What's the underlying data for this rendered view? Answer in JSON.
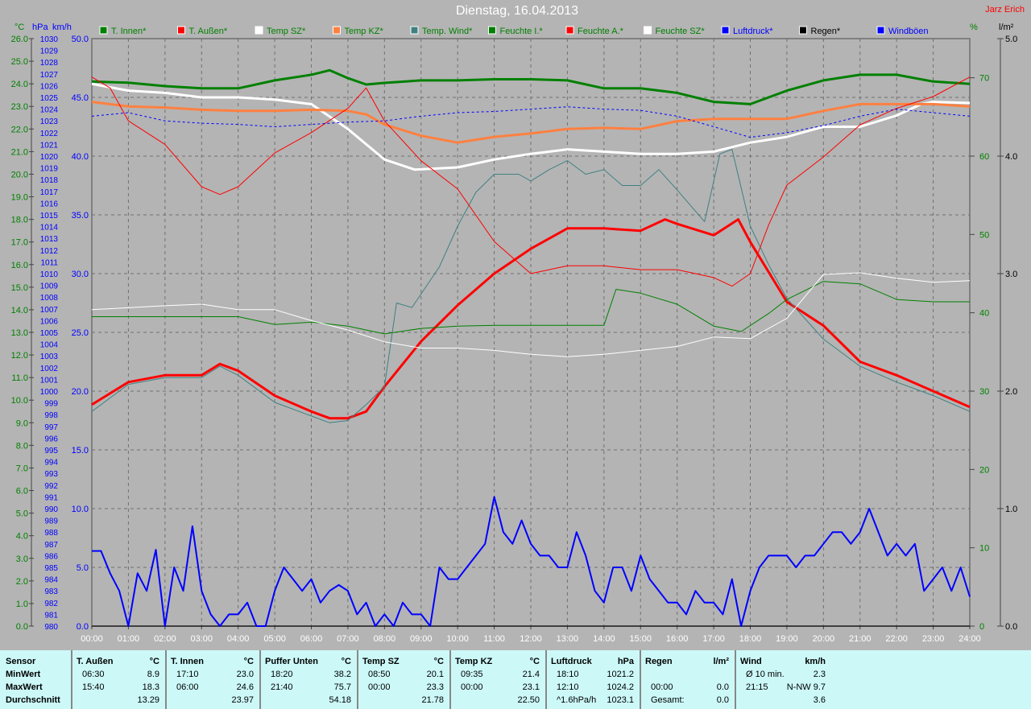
{
  "header": {
    "title": "Dienstag, 16.04.2013",
    "author": "Jarz Erich"
  },
  "axis_units": {
    "celsius": "°C",
    "hpa": "hPa",
    "kmh": "km/h",
    "percent": "%",
    "rain": "l/m²"
  },
  "chart_data": {
    "type": "line",
    "title": "Dienstag, 16.04.2013",
    "xlim": [
      0,
      24
    ],
    "x_ticks": [
      "00:00",
      "01:00",
      "02:00",
      "03:00",
      "04:00",
      "05:00",
      "06:00",
      "07:00",
      "08:00",
      "09:00",
      "10:00",
      "11:00",
      "12:00",
      "13:00",
      "14:00",
      "15:00",
      "16:00",
      "17:00",
      "18:00",
      "19:00",
      "20:00",
      "21:00",
      "22:00",
      "23:00",
      "24:00"
    ],
    "axes": {
      "celsius": {
        "range": [
          0,
          26
        ],
        "ticks": [
          "0.0",
          "1.0",
          "2.0",
          "3.0",
          "4.0",
          "5.0",
          "6.0",
          "7.0",
          "8.0",
          "9.0",
          "10.0",
          "11.0",
          "12.0",
          "13.0",
          "14.0",
          "15.0",
          "16.0",
          "17.0",
          "18.0",
          "19.0",
          "20.0",
          "21.0",
          "22.0",
          "23.0",
          "24.0",
          "25.0",
          "26.0"
        ],
        "color": "#008000"
      },
      "hpa": {
        "range": [
          980,
          1030
        ],
        "color": "#0000ff"
      },
      "kmh": {
        "range": [
          0,
          50
        ],
        "ticks": [
          "0.0",
          "5.0",
          "10.0",
          "15.0",
          "20.0",
          "25.0",
          "30.0",
          "35.0",
          "40.0",
          "45.0",
          "50.0"
        ],
        "color": "#0000ff"
      },
      "percent": {
        "range": [
          0,
          75
        ],
        "ticks": [
          "0",
          "10",
          "20",
          "30",
          "40",
          "50",
          "60",
          "70"
        ],
        "color": "#008000"
      },
      "rain": {
        "range": [
          0,
          5
        ],
        "ticks": [
          "0.0",
          "1.0",
          "2.0",
          "3.0",
          "4.0",
          "5.0"
        ],
        "color": "#000000"
      }
    },
    "grid": true,
    "legend_position": "top",
    "series": [
      {
        "name": "T. Innen*",
        "color": "#008000",
        "axis": "celsius",
        "width": 3,
        "x": [
          0,
          1,
          2,
          3,
          4,
          5,
          6,
          6.5,
          7,
          7.5,
          8,
          9,
          10,
          11,
          12,
          13,
          14,
          15,
          16,
          17,
          18,
          19,
          20,
          21,
          22,
          23,
          24
        ],
        "y": [
          24.1,
          24.05,
          23.9,
          23.8,
          23.8,
          24.15,
          24.4,
          24.6,
          24.25,
          23.97,
          24.04,
          24.15,
          24.15,
          24.2,
          24.2,
          24.15,
          23.8,
          23.8,
          23.6,
          23.2,
          23.1,
          23.7,
          24.15,
          24.4,
          24.4,
          24.1,
          24.0
        ]
      },
      {
        "name": "T. Außen*",
        "color": "#ff0000",
        "axis": "celsius",
        "width": 3,
        "x": [
          0,
          1,
          2,
          3,
          3.5,
          4,
          5,
          6,
          6.5,
          7,
          7.5,
          8,
          9,
          10,
          11,
          12,
          13,
          14,
          15,
          15.67,
          16,
          17,
          17.67,
          18,
          19,
          20,
          21,
          22,
          23,
          24
        ],
        "y": [
          9.8,
          10.8,
          11.1,
          11.1,
          11.6,
          11.3,
          10.2,
          9.5,
          9.2,
          9.2,
          9.5,
          10.6,
          12.6,
          14.2,
          15.6,
          16.7,
          17.6,
          17.6,
          17.5,
          18.0,
          17.8,
          17.3,
          18.0,
          17.0,
          14.35,
          13.3,
          11.7,
          11.1,
          10.4,
          9.7
        ]
      },
      {
        "name": "Temp SZ*",
        "color": "#ffffff",
        "axis": "celsius",
        "width": 3,
        "x": [
          0,
          1,
          2,
          3,
          4,
          5,
          6,
          7,
          7.67,
          8,
          8.83,
          10,
          11,
          12,
          13,
          14,
          15,
          16,
          17,
          17.5,
          18,
          19,
          20,
          21,
          22,
          22.67,
          23,
          24
        ],
        "y": [
          24.0,
          23.7,
          23.6,
          23.4,
          23.4,
          23.3,
          23.1,
          22.0,
          21.1,
          20.65,
          20.2,
          20.3,
          20.65,
          20.9,
          21.1,
          21.0,
          20.9,
          20.9,
          21.0,
          21.2,
          21.4,
          21.65,
          22.1,
          22.1,
          22.6,
          23.1,
          23.2,
          23.15
        ]
      },
      {
        "name": "Temp KZ*",
        "color": "#ff8040",
        "axis": "celsius",
        "width": 3,
        "x": [
          0,
          1,
          2,
          3,
          4,
          5,
          6,
          7,
          7.5,
          8,
          9,
          10,
          11,
          12,
          13,
          14,
          15,
          16,
          17,
          18,
          19,
          20,
          21,
          22,
          23,
          24
        ],
        "y": [
          23.2,
          23.0,
          22.95,
          22.85,
          22.8,
          22.8,
          22.85,
          22.8,
          22.65,
          22.2,
          21.7,
          21.4,
          21.65,
          21.8,
          22.0,
          22.05,
          22.0,
          22.35,
          22.45,
          22.45,
          22.45,
          22.8,
          23.1,
          23.1,
          23.1,
          23.0
        ]
      },
      {
        "name": "Temp. Wind*",
        "color": "#408080",
        "axis": "celsius",
        "width": 1,
        "x": [
          0,
          1,
          2,
          3,
          3.5,
          4,
          5,
          6,
          6.5,
          7,
          7.5,
          8,
          8.33,
          8.75,
          9.5,
          10,
          10.5,
          11,
          11.67,
          12,
          12.5,
          13,
          13.5,
          14,
          14.5,
          15,
          15.5,
          16,
          16.75,
          17.17,
          17.5,
          18,
          18.5,
          19,
          20,
          21,
          22,
          23,
          24
        ],
        "y": [
          9.5,
          10.7,
          11.0,
          11.0,
          11.5,
          11.1,
          9.9,
          9.3,
          9.0,
          9.1,
          9.8,
          10.6,
          14.3,
          14.1,
          15.9,
          17.7,
          19.2,
          20.0,
          20.0,
          19.7,
          20.2,
          20.6,
          20.0,
          20.2,
          19.5,
          19.5,
          20.2,
          19.3,
          17.9,
          20.9,
          21.1,
          17.7,
          16.0,
          14.5,
          12.7,
          11.5,
          10.8,
          10.2,
          9.5
        ]
      },
      {
        "name": "Feuchte I.*",
        "color": "#008000",
        "axis": "percent",
        "width": 1,
        "x": [
          0,
          4,
          5,
          6,
          7,
          8,
          9,
          10,
          11,
          14,
          14.33,
          15,
          16,
          17,
          17.75,
          18.5,
          19,
          20,
          21,
          22,
          23,
          24
        ],
        "y": [
          39.5,
          39.5,
          38.5,
          38.8,
          38.3,
          37.3,
          38.0,
          38.3,
          38.4,
          38.4,
          43.0,
          42.5,
          41.1,
          38.3,
          37.6,
          39.9,
          41.7,
          44.0,
          43.7,
          41.7,
          41.4,
          41.4
        ]
      },
      {
        "name": "Feuchte A.*",
        "color": "#ff0000",
        "axis": "percent",
        "width": 1,
        "x": [
          0,
          0.5,
          1,
          2,
          3,
          3.5,
          4,
          5,
          6,
          7,
          7.5,
          8,
          9,
          10,
          11,
          12,
          13,
          14,
          15,
          16,
          17,
          17.5,
          18,
          18.5,
          19,
          20,
          21,
          22,
          23,
          24
        ],
        "y": [
          70.1,
          68.7,
          64.5,
          61.5,
          56.1,
          55.1,
          56.1,
          60.4,
          63.0,
          66.1,
          68.7,
          64.5,
          59.4,
          55.8,
          49.1,
          45.0,
          46.0,
          46.0,
          45.5,
          45.5,
          44.5,
          43.4,
          45.0,
          51.2,
          56.3,
          59.9,
          64.0,
          66.1,
          67.6,
          70.1
        ]
      },
      {
        "name": "Feuchte SZ*",
        "color": "#ffffff",
        "axis": "percent",
        "width": 1,
        "x": [
          0,
          2,
          3,
          4,
          5,
          6,
          7,
          8,
          9,
          10,
          11,
          12,
          13,
          14,
          15,
          16,
          17,
          18,
          19,
          20,
          21,
          22,
          23,
          24
        ],
        "y": [
          40.4,
          40.9,
          41.1,
          40.4,
          40.4,
          39.0,
          37.8,
          36.3,
          35.5,
          35.5,
          35.2,
          34.7,
          34.4,
          34.7,
          35.2,
          35.7,
          36.9,
          36.7,
          39.3,
          44.9,
          45.1,
          44.4,
          43.9,
          44.1
        ]
      },
      {
        "name": "Luftdruck*",
        "color": "#0000ff",
        "axis": "hpa",
        "width": 1,
        "dashed": true,
        "x": [
          0,
          1,
          2,
          3,
          4,
          5,
          6,
          7,
          8,
          9,
          10,
          11,
          12,
          13,
          14,
          15,
          16,
          17,
          18,
          19,
          20,
          21,
          22,
          23,
          24
        ],
        "y": [
          1023.4,
          1023.7,
          1023.0,
          1022.8,
          1022.7,
          1022.5,
          1022.7,
          1022.9,
          1023.0,
          1023.4,
          1023.7,
          1023.8,
          1024.0,
          1024.2,
          1024.0,
          1023.9,
          1023.4,
          1022.5,
          1021.6,
          1022.0,
          1022.6,
          1023.4,
          1024.0,
          1023.7,
          1023.4
        ]
      },
      {
        "name": "Regen*",
        "color": "#000000",
        "axis": "rain",
        "width": 1,
        "x": [
          0,
          24
        ],
        "y": [
          0,
          0
        ]
      },
      {
        "name": "Windböen",
        "color": "#0000ff",
        "axis": "kmh",
        "width": 2,
        "x": [
          0,
          0.25,
          0.5,
          0.75,
          1,
          1.25,
          1.5,
          1.75,
          2,
          2.25,
          2.5,
          2.75,
          3,
          3.25,
          3.5,
          3.75,
          4,
          4.25,
          4.5,
          4.75,
          5,
          5.25,
          5.5,
          5.75,
          6,
          6.25,
          6.5,
          6.75,
          7,
          7.25,
          7.5,
          7.75,
          8,
          8.25,
          8.5,
          8.75,
          9,
          9.25,
          9.5,
          9.75,
          10,
          10.25,
          10.5,
          10.75,
          11,
          11.25,
          11.5,
          11.75,
          12,
          12.25,
          12.5,
          12.75,
          13,
          13.25,
          13.5,
          13.75,
          14,
          14.25,
          14.5,
          14.75,
          15,
          15.25,
          15.5,
          15.75,
          16,
          16.25,
          16.5,
          16.75,
          17,
          17.25,
          17.5,
          17.75,
          18,
          18.25,
          18.5,
          18.75,
          19,
          19.25,
          19.5,
          19.75,
          20,
          20.25,
          20.5,
          20.75,
          21,
          21.25,
          21.5,
          21.75,
          22,
          22.25,
          22.5,
          22.75,
          23,
          23.25,
          23.5,
          23.75,
          24
        ],
        "y": [
          6.4,
          6.4,
          4.5,
          3,
          0,
          4.5,
          3,
          6.5,
          0,
          5,
          3,
          8.5,
          3,
          1,
          0,
          1,
          1,
          2,
          0,
          0,
          3,
          5,
          4,
          3,
          4,
          2,
          3,
          3.5,
          3,
          1,
          2,
          0,
          1,
          0,
          2,
          1,
          1,
          0,
          5,
          4,
          4,
          5,
          6,
          7,
          11,
          8,
          7,
          9,
          7,
          6,
          6,
          5,
          5,
          8,
          6,
          3,
          2,
          5,
          5,
          3,
          6,
          4,
          3,
          2,
          2,
          1,
          3,
          2,
          2,
          1,
          4,
          0,
          3,
          5,
          6,
          6,
          6,
          5,
          6,
          6,
          7,
          8,
          8,
          7,
          8,
          10,
          8,
          6,
          7,
          6,
          7,
          3,
          4,
          5,
          3,
          5,
          2.5
        ]
      }
    ]
  },
  "table": {
    "columns": [
      {
        "header": "Sensor",
        "unit": "",
        "rows": [
          {
            "time": "MinWert",
            "value": ""
          },
          {
            "time": "MaxWert",
            "value": ""
          },
          {
            "time": "Durchschnitt",
            "value": ""
          }
        ]
      },
      {
        "header": "T. Außen",
        "unit": "°C",
        "rows": [
          {
            "time": "06:30",
            "value": "8.9"
          },
          {
            "time": "15:40",
            "value": "18.3"
          },
          {
            "time": "",
            "value": "13.29"
          }
        ]
      },
      {
        "header": "T. Innen",
        "unit": "°C",
        "rows": [
          {
            "time": "17:10",
            "value": "23.0"
          },
          {
            "time": "06:00",
            "value": "24.6"
          },
          {
            "time": "",
            "value": "23.97"
          }
        ]
      },
      {
        "header": "Puffer Unten",
        "unit": "°C",
        "rows": [
          {
            "time": "18:20",
            "value": "38.2"
          },
          {
            "time": "21:40",
            "value": "75.7"
          },
          {
            "time": "",
            "value": "54.18"
          }
        ]
      },
      {
        "header": "Temp SZ",
        "unit": "°C",
        "rows": [
          {
            "time": "08:50",
            "value": "20.1"
          },
          {
            "time": "00:00",
            "value": "23.3"
          },
          {
            "time": "",
            "value": "21.78"
          }
        ]
      },
      {
        "header": "Temp KZ",
        "unit": "°C",
        "rows": [
          {
            "time": "09:35",
            "value": "21.4"
          },
          {
            "time": "00:00",
            "value": "23.1"
          },
          {
            "time": "",
            "value": "22.50"
          }
        ]
      },
      {
        "header": "Luftdruck",
        "unit": "hPa",
        "rows": [
          {
            "time": "18:10",
            "value": "1021.2"
          },
          {
            "time": "12:10",
            "value": "1024.2"
          },
          {
            "time": "^1.6hPa/h",
            "value": "1023.1"
          }
        ]
      },
      {
        "header": "Regen",
        "unit": "l/m²",
        "rows": [
          {
            "time": "",
            "value": ""
          },
          {
            "time": "00:00",
            "value": "0.0"
          },
          {
            "time": "Gesamt:",
            "value": "0.0"
          }
        ]
      },
      {
        "header": "Wind",
        "unit": "km/h",
        "rows": [
          {
            "time": "Ø 10 min.",
            "value": "2.3"
          },
          {
            "time": "21:15",
            "value": "N-NW 9.7"
          },
          {
            "time": "",
            "value": "3.6"
          }
        ]
      }
    ]
  }
}
